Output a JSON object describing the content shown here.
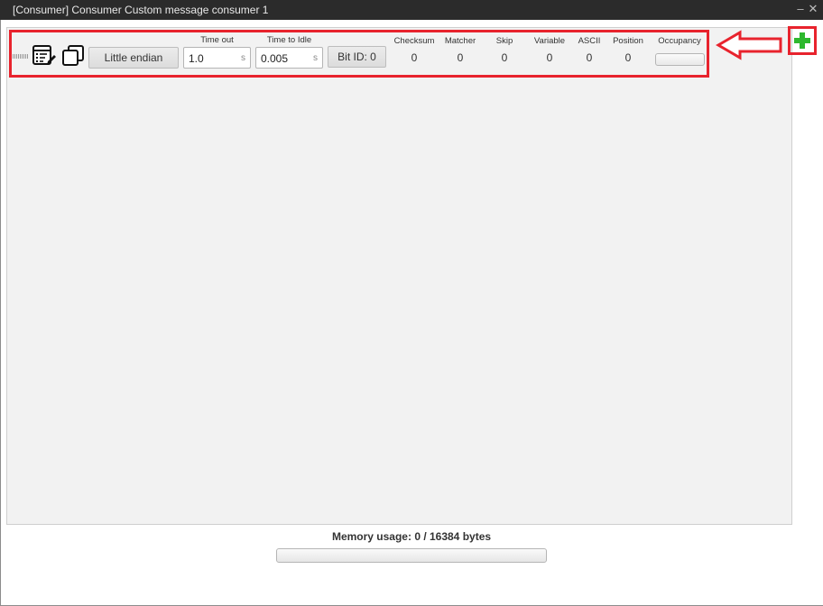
{
  "window": {
    "title": "[Consumer] Consumer Custom message consumer 1"
  },
  "titlebar_buttons": {
    "minimize": "–",
    "close": "✕"
  },
  "toolbar": {
    "endian_label": "Little endian",
    "timeout": {
      "label": "Time out",
      "value": "1.0",
      "unit": "s"
    },
    "time_to_idle": {
      "label": "Time to Idle",
      "value": "0.005",
      "unit": "s"
    },
    "bit_id_label": "Bit ID: 0",
    "stats": [
      {
        "label": "Checksum",
        "value": "0"
      },
      {
        "label": "Matcher",
        "value": "0"
      },
      {
        "label": "Skip",
        "value": "0"
      },
      {
        "label": "Variable",
        "value": "0"
      },
      {
        "label": "ASCII",
        "value": "0"
      },
      {
        "label": "Position",
        "value": "0"
      }
    ],
    "occupancy": {
      "label": "Occupancy",
      "level": 0
    }
  },
  "icons": {
    "drag": "drag-handle-icon",
    "edit_list": "edit-list-icon",
    "copy": "copy-icon",
    "add": "add-icon",
    "arrow": "arrow-left-icon"
  },
  "colors": {
    "highlight": "#e8232d",
    "add_green": "#2eb82e",
    "titlebar_bg": "#2b2b2b",
    "workspace_bg": "#f2f2f2"
  },
  "memory": {
    "label": "Memory usage: 0 / 16384 bytes",
    "used": 0,
    "total": 16384
  }
}
